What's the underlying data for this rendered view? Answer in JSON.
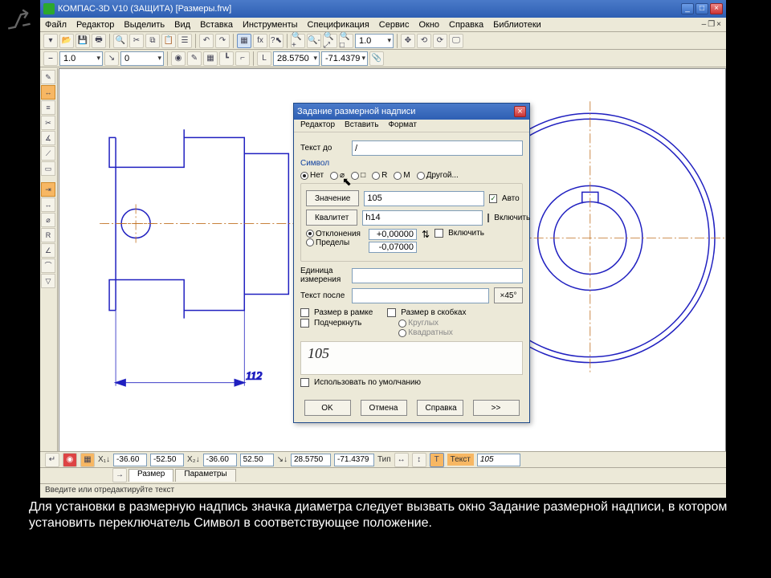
{
  "title": "КОМПАС-3D V10 (ЗАЩИТА)   [Размеры.frw]",
  "menus": [
    "Файл",
    "Редактор",
    "Выделить",
    "Вид",
    "Вставка",
    "Инструменты",
    "Спецификация",
    "Сервис",
    "Окно",
    "Справка",
    "Библиотеки"
  ],
  "toolbar2_zoom": "1.0",
  "toolbar2_step": "0",
  "coord_x": "28.5750",
  "coord_y": "-71.4379",
  "zoom_combo": "1.0",
  "bottom": {
    "x1": "-36.60",
    "y1": "-52.50",
    "x2": "-36.60",
    "y2": "52.50",
    "rx": "28.5750",
    "ry": "-71.4379",
    "text_label": "Текст",
    "text_val": "105",
    "type_label": "Тип",
    "tab_size": "Размер",
    "tab_params": "Параметры"
  },
  "status": "Введите или отредактируйте текст",
  "drawing": {
    "dim_text": "112"
  },
  "dialog": {
    "title": "Задание размерной надписи",
    "menus": [
      "Редактор",
      "Вставить",
      "Формат"
    ],
    "text_before_label": "Текст до",
    "text_before_val": "/",
    "symbol_group": "Символ",
    "sym_none": "Нет",
    "sym_diam": "⌀",
    "sym_square": "□",
    "sym_r": "R",
    "sym_m": "M",
    "sym_other": "Другой...",
    "value_btn": "Значение",
    "value_val": "105",
    "auto_label": "Авто",
    "qual_btn": "Квалитет",
    "qual_val": "h14",
    "qual_incl": "Включить",
    "dev_label": "Отклонения",
    "dev_plus": "+0,00000",
    "dev_minus": "-0,07000",
    "limits_label": "Пределы",
    "dev_incl": "Включить",
    "unit_label": "Единица измерения",
    "text_after_label": "Текст после",
    "x45_btn": "×45°",
    "bracket_label": "Размер в скобках",
    "round_label": "Круглых",
    "square_label": "Квадратных",
    "frame_label": "Размер в рамке",
    "underline_label": "Подчеркнуть",
    "preview": "105",
    "default_label": "Использовать по умолчанию",
    "ok": "OK",
    "cancel": "Отмена",
    "help": "Справка",
    "more": ">>"
  },
  "caption": "Для установки в размерную надпись значка диаметра следует вызвать окно Задание размерной надписи, в котором установить переключатель Символ в соответствующее положение."
}
